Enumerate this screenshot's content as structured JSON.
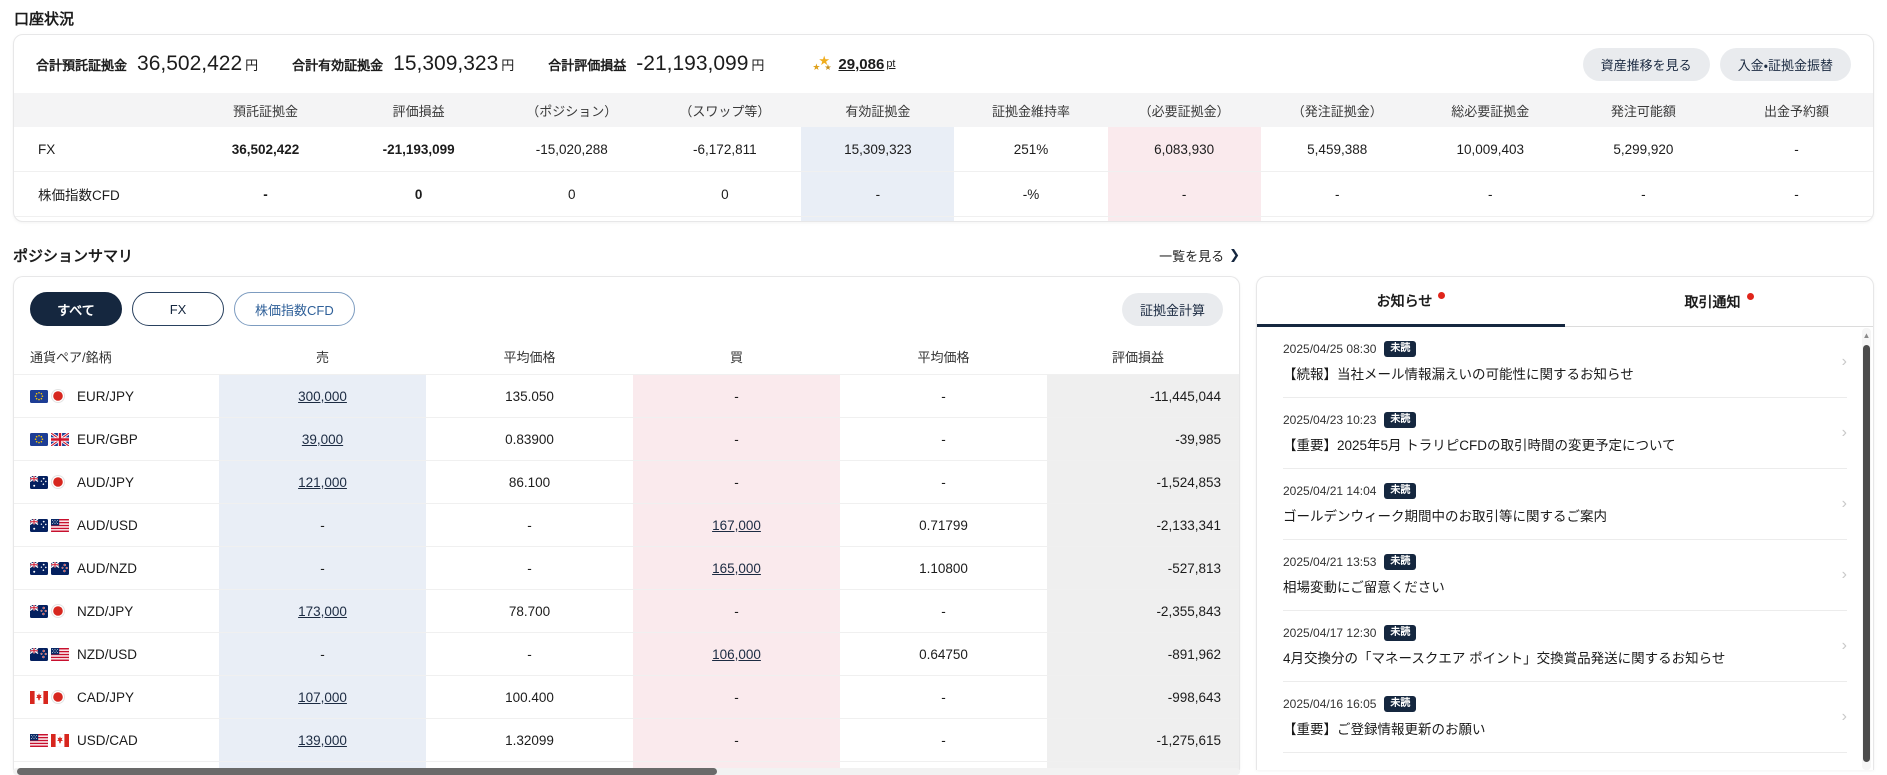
{
  "page": {
    "title": "口座状況"
  },
  "icons": {
    "points_star": "★",
    "view_all_chevron": "❯",
    "chevron_right": "›",
    "scroll_up_arrow": "▲"
  },
  "colors": {
    "brand_navy": "#15273f",
    "sell_column_bg": "#e9eef6",
    "buy_column_bg": "#faeaed",
    "pl_column_bg": "#efefef",
    "unread_dot_red": "#e0251b",
    "points_star_gold": "#f0ad1d"
  },
  "account": {
    "summary": [
      {
        "label": "合計預託証拠金",
        "value": "36,502,422",
        "unit": "円"
      },
      {
        "label": "合計有効証拠金",
        "value": "15,309,323",
        "unit": "円"
      },
      {
        "label": "合計評価損益",
        "value": "-21,193,099",
        "unit": "円"
      }
    ],
    "points": {
      "value": "29,086",
      "unit": "pt"
    },
    "buttons": {
      "asset_history": "資産推移を見る",
      "deposit_transfer": "入金・証拠金振替"
    },
    "table": {
      "columns": [
        "預託証拠金",
        "評価損益",
        "（ポジション）",
        "（スワップ等）",
        "有効証拠金",
        "証拠金維持率",
        "（必要証拠金）",
        "（発注証拠金）",
        "総必要証拠金",
        "発注可能額",
        "出金予約額"
      ],
      "rows": [
        {
          "label": "FX",
          "values": [
            "36,502,422",
            "-21,193,099",
            "-15,020,288",
            "-6,172,811",
            "15,309,323",
            "251%",
            "6,083,930",
            "5,459,388",
            "10,009,403",
            "5,299,920",
            "-"
          ]
        },
        {
          "label": "株価指数CFD",
          "values": [
            "-",
            "0",
            "0",
            "0",
            "-",
            "-%",
            "-",
            "-",
            "-",
            "-",
            "-"
          ]
        }
      ]
    }
  },
  "positions": {
    "title": "ポジションサマリ",
    "view_all": "一覧を見る",
    "tabs": [
      {
        "label": "すべて",
        "active": true
      },
      {
        "label": "FX",
        "active": false
      },
      {
        "label": "株価指数CFD",
        "active": false
      }
    ],
    "calc_button": "証拠金計算",
    "columns": [
      "通貨ペア/銘柄",
      "売",
      "平均価格",
      "買",
      "平均価格",
      "評価損益"
    ],
    "rows": [
      {
        "pair": "EUR/JPY",
        "flags": [
          "eu",
          "jp"
        ],
        "sell": "300,000",
        "sell_avg": "135.050",
        "buy": "-",
        "buy_avg": "-",
        "pl": "-11,445,044"
      },
      {
        "pair": "EUR/GBP",
        "flags": [
          "eu",
          "gb"
        ],
        "sell": "39,000",
        "sell_avg": "0.83900",
        "buy": "-",
        "buy_avg": "-",
        "pl": "-39,985"
      },
      {
        "pair": "AUD/JPY",
        "flags": [
          "au",
          "jp"
        ],
        "sell": "121,000",
        "sell_avg": "86.100",
        "buy": "-",
        "buy_avg": "-",
        "pl": "-1,524,853"
      },
      {
        "pair": "AUD/USD",
        "flags": [
          "au",
          "us"
        ],
        "sell": "-",
        "sell_avg": "-",
        "buy": "167,000",
        "buy_avg": "0.71799",
        "pl": "-2,133,341"
      },
      {
        "pair": "AUD/NZD",
        "flags": [
          "au",
          "nz"
        ],
        "sell": "-",
        "sell_avg": "-",
        "buy": "165,000",
        "buy_avg": "1.10800",
        "pl": "-527,813"
      },
      {
        "pair": "NZD/JPY",
        "flags": [
          "nz",
          "jp"
        ],
        "sell": "173,000",
        "sell_avg": "78.700",
        "buy": "-",
        "buy_avg": "-",
        "pl": "-2,355,843"
      },
      {
        "pair": "NZD/USD",
        "flags": [
          "nz",
          "us"
        ],
        "sell": "-",
        "sell_avg": "-",
        "buy": "106,000",
        "buy_avg": "0.64750",
        "pl": "-891,962"
      },
      {
        "pair": "CAD/JPY",
        "flags": [
          "ca",
          "jp"
        ],
        "sell": "107,000",
        "sell_avg": "100.400",
        "buy": "-",
        "buy_avg": "-",
        "pl": "-998,643"
      },
      {
        "pair": "USD/CAD",
        "flags": [
          "us",
          "ca"
        ],
        "sell": "139,000",
        "sell_avg": "1.32099",
        "buy": "-",
        "buy_avg": "-",
        "pl": "-1,275,615"
      }
    ]
  },
  "notifications": {
    "tabs": [
      {
        "label": "お知らせ",
        "active": true
      },
      {
        "label": "取引通知",
        "active": false
      }
    ],
    "unread_label": "未読",
    "items": [
      {
        "datetime": "2025/04/25 08:30",
        "title": "【続報】当社メール情報漏えいの可能性に関するお知らせ"
      },
      {
        "datetime": "2025/04/23 10:23",
        "title": "【重要】2025年5月 トラリピCFDの取引時間の変更予定について"
      },
      {
        "datetime": "2025/04/21 14:04",
        "title": "ゴールデンウィーク期間中のお取引等に関するご案内"
      },
      {
        "datetime": "2025/04/21 13:53",
        "title": "相場変動にご留意ください"
      },
      {
        "datetime": "2025/04/17 12:30",
        "title": "4月交換分の「マネースクエア ポイント」交換賞品発送に関するお知らせ"
      },
      {
        "datetime": "2025/04/16 16:05",
        "title": "【重要】ご登録情報更新のお願い"
      }
    ]
  }
}
